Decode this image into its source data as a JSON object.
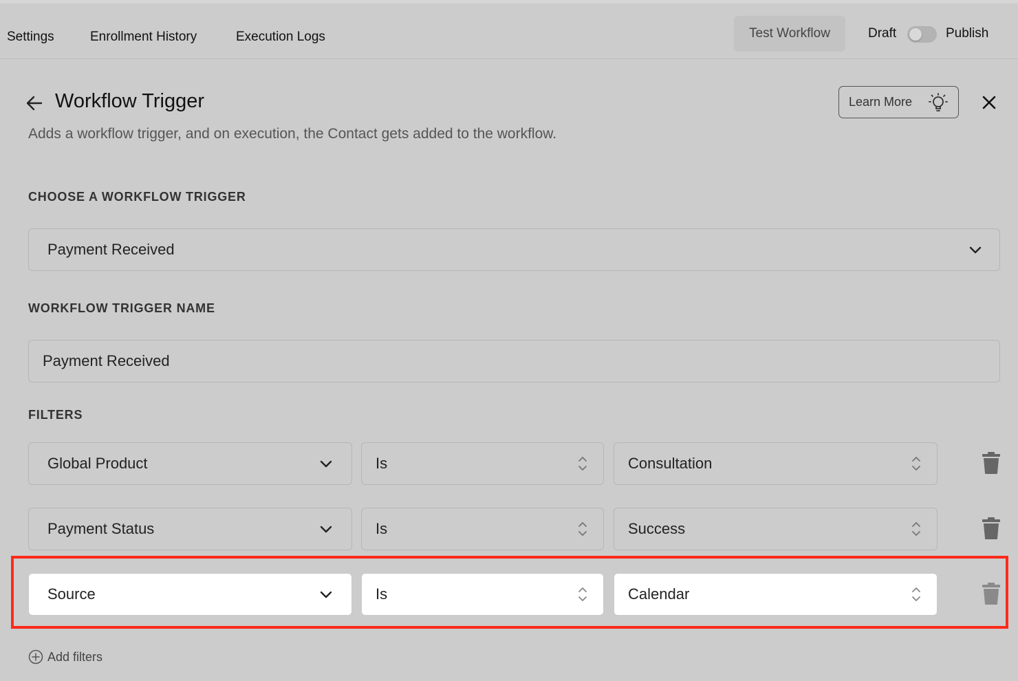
{
  "topnav": {
    "settings": "Settings",
    "enrollment_history": "Enrollment History",
    "execution_logs": "Execution Logs",
    "test_workflow": "Test Workflow",
    "draft": "Draft",
    "publish": "Publish"
  },
  "panel": {
    "title": "Workflow Trigger",
    "subtitle": "Adds a workflow trigger, and on execution, the Contact gets added to the workflow.",
    "learn_more": "Learn More"
  },
  "trigger": {
    "choose_label": "CHOOSE A WORKFLOW TRIGGER",
    "selected": "Payment Received",
    "name_label": "WORKFLOW TRIGGER NAME",
    "name_value": "Payment Received"
  },
  "filters": {
    "label": "FILTERS",
    "rows": [
      {
        "field": "Global Product",
        "operator": "Is",
        "value": "Consultation"
      },
      {
        "field": "Payment Status",
        "operator": "Is",
        "value": "Success"
      },
      {
        "field": "Source",
        "operator": "Is",
        "value": "Calendar"
      }
    ],
    "add_label": "Add filters"
  },
  "colors": {
    "overlay_bg": "#cccccc",
    "highlight_border": "#ff2a1a",
    "active_row_bg": "#ffffff"
  }
}
